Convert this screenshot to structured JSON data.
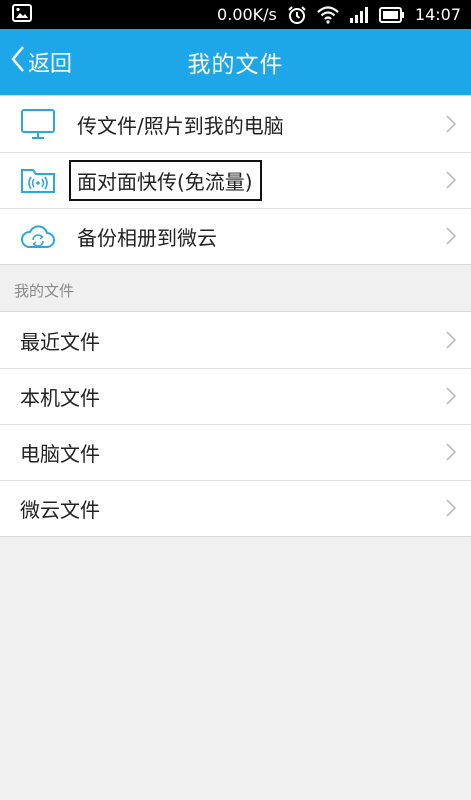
{
  "status_bar": {
    "network_speed": "0.00K/s",
    "time": "14:07",
    "icons": [
      "image-icon",
      "alarm-icon",
      "wifi-icon",
      "signal-icon",
      "battery-icon"
    ]
  },
  "nav": {
    "back_label": "返回",
    "title": "我的文件"
  },
  "actions": [
    {
      "label": "传文件/照片到我的电脑",
      "icon": "monitor-icon"
    },
    {
      "label": "面对面快传(免流量)",
      "icon": "folder-wireless-icon"
    },
    {
      "label": "备份相册到微云",
      "icon": "cloud-sync-icon"
    }
  ],
  "section_header": "我的文件",
  "files": [
    {
      "label": "最近文件"
    },
    {
      "label": "本机文件"
    },
    {
      "label": "电脑文件"
    },
    {
      "label": "微云文件"
    }
  ],
  "colors": {
    "nav_background": "#1ea7e8",
    "icon_blue": "#2ba6de",
    "page_background": "#f0f0f0"
  }
}
